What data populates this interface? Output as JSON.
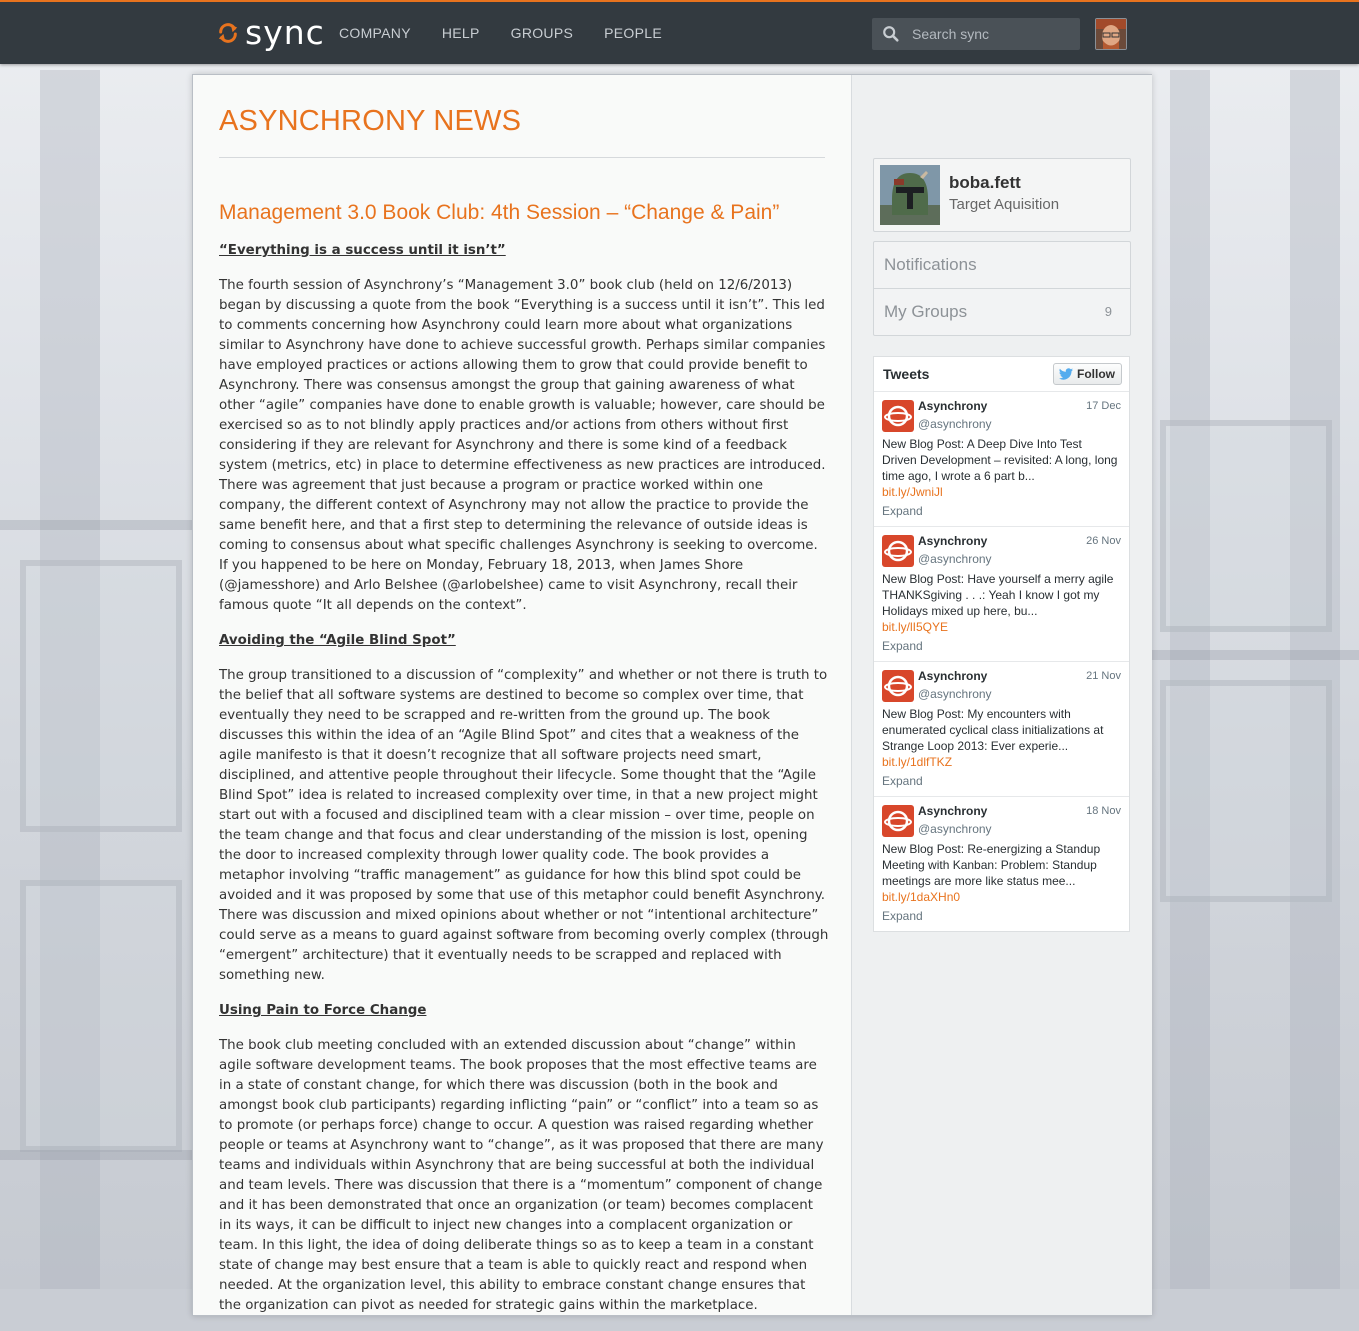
{
  "nav": {
    "logo_text": "sync",
    "items": [
      {
        "label": "COMPANY"
      },
      {
        "label": "HELP"
      },
      {
        "label": "GROUPS"
      },
      {
        "label": "PEOPLE"
      }
    ],
    "search_placeholder": "Search sync"
  },
  "colors": {
    "accent": "#e8731e",
    "topbar": "#333a40"
  },
  "main": {
    "page_title": "ASYNCHRONY NEWS",
    "post_title": "Management 3.0 Book Club: 4th Session – “Change & Pain”",
    "sections": [
      {
        "heading": "“Everything is a success until it isn’t”",
        "paragraph": "The fourth session of Asynchrony’s “Management 3.0” book club (held on 12/6/2013) began by discussing a quote from the book “Everything is a success until it isn’t”.  This led to comments concerning how Asynchrony could learn more about what organizations similar to Asynchrony have done to achieve successful growth.  Perhaps similar companies have employed practices or actions allowing them to grow that could provide benefit to Asynchrony.  There was consensus amongst the group that gaining awareness of what other “agile” companies have done to enable growth is valuable; however, care should be exercised so as to not blindly apply practices and/or actions from others without first considering if they are relevant for Asynchrony and there is some kind of a feedback system (metrics, etc) in place to determine effectiveness as new practices are introduced.  There was agreement that just because a program or practice worked within one company, the different context of Asynchrony may not allow the practice to provide the same benefit here, and that a first step to determining the relevance of outside ideas is coming to consensus about what specific challenges Asynchrony is seeking to overcome.  If you happened to be here on Monday, February 18, 2013, when James Shore (@jamesshore) and Arlo Belshee (@arlobelshee) came to visit Asynchrony, recall their famous quote “It all depends on the context”."
      },
      {
        "heading": "Avoiding the “Agile Blind Spot”",
        "paragraph": "The group transitioned to a discussion of “complexity” and whether or not there is truth to the belief that all software systems are destined to become so complex over time, that eventually they need to be scrapped and re-written from the ground up.  The book discusses this within the idea of an “Agile Blind Spot” and cites that a weakness of the agile manifesto is that it doesn’t recognize that all software projects need smart, disciplined, and attentive people throughout their lifecycle.  Some thought that the “Agile Blind Spot” idea is related to increased complexity over time, in that a new project might start out with a focused and disciplined team with a clear mission – over time, people on the team change and that focus and clear understanding of the mission is lost, opening the door to increased complexity through lower quality code.  The book provides a metaphor involving “traffic management” as guidance for how this blind spot could be avoided and it was proposed by some that use of this metaphor could benefit Asynchrony.  There was discussion and mixed opinions about whether or not “intentional architecture” could serve as a means to guard against software from becoming overly complex (through “emergent” architecture) that it eventually needs to be scrapped and replaced with something new."
      },
      {
        "heading": "Using Pain to Force Change",
        "paragraph": "The book club meeting concluded with an extended discussion about “change” within agile software development teams.  The book proposes that the most effective teams are in a state of constant change, for which there was discussion (both in the book and amongst book club participants) regarding inflicting “pain” or “conflict” into a team so as to promote (or perhaps force) change to occur.  A question was raised regarding whether people or teams at Asynchrony want to “change”, as it was proposed that there are many teams and individuals within Asynchrony that are being successful at both the individual and team levels.  There was discussion that there is a “momentum” component of change and it has been demonstrated that once an organization (or team) becomes complacent in its ways, it can be difficult to inject new changes into a complacent organization or team.  In this light, the idea of doing deliberate things so as to keep a team in a constant state of change may best ensure that a team is able to quickly react and respond when needed.  At the organization level, this ability to embrace constant change ensures that the organization can pivot as needed for strategic gains within the marketplace."
      }
    ]
  },
  "sidebar": {
    "profile": {
      "username": "boba.fett",
      "title": "Target Aquisition"
    },
    "menu": [
      {
        "label": "Notifications",
        "count": ""
      },
      {
        "label": "My Groups",
        "count": "9"
      }
    ],
    "tweets": {
      "title": "Tweets",
      "follow_label": "Follow",
      "expand_label": "Expand",
      "items": [
        {
          "name": "Asynchrony",
          "handle": "@asynchrony",
          "date": "17 Dec",
          "text": "New Blog Post: A Deep Dive Into Test Driven Development – revisited: A long, long time ago, I wrote a 6 part b...",
          "link": "bit.ly/JwniJl"
        },
        {
          "name": "Asynchrony",
          "handle": "@asynchrony",
          "date": "26 Nov",
          "text": "New Blog Post: Have yourself a merry agile THANKSgiving . . .: Yeah I know I got my Holidays mixed up here, bu...",
          "link": "bit.ly/lI5QYE"
        },
        {
          "name": "Asynchrony",
          "handle": "@asynchrony",
          "date": "21 Nov",
          "text": "New Blog Post: My encounters with enumerated cyclical class initializations at Strange Loop 2013: Ever experie...",
          "link": "bit.ly/1dlfTKZ"
        },
        {
          "name": "Asynchrony",
          "handle": "@asynchrony",
          "date": "18 Nov",
          "text": "New Blog Post: Re-energizing a Standup Meeting with Kanban: Problem: Standup meetings are more like status mee...",
          "link": "bit.ly/1daXHn0"
        }
      ]
    }
  }
}
